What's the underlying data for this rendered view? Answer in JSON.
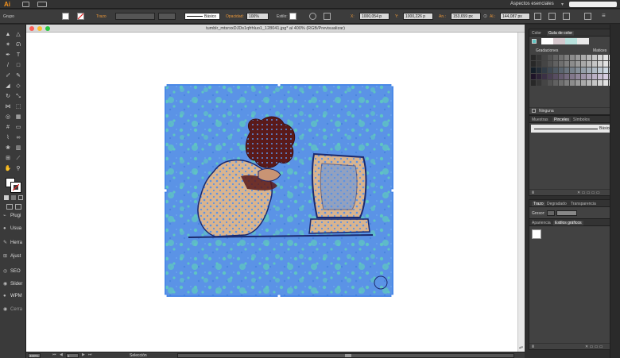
{
  "app": {
    "logo": "Ai",
    "workspace": "Aspectos esenciales"
  },
  "control_bar": {
    "selection_label": "Grupo",
    "stroke_label": "Trazo",
    "brush_label": "Básico",
    "opacity_label": "Opacidad:",
    "opacity_value": "100%",
    "style_label": "Estilo:",
    "x_label": "X:",
    "x_value": "1000,054 p",
    "y_label": "Y:",
    "y_value": "1000,226 p",
    "w_label": "An.:",
    "w_value": "153,659 px",
    "h_label": "Al.:",
    "h_value": "144,087 px"
  },
  "document": {
    "title": "tumblr_mtsrxxDJDs1qfrhluo1_128041.jpg* al 400% (RGB/Previsualizar)",
    "zoom": "400%",
    "page": "1",
    "status": "Selección"
  },
  "left_panels": [
    "Plugi",
    "Usua",
    "Herra",
    "Ajust",
    "SEO",
    "Slider",
    "WPM",
    "Cerra"
  ],
  "color_panel": {
    "tabs": [
      "Color",
      "Guía de color"
    ],
    "group_headers": [
      "Gradaciones",
      "Matices"
    ],
    "footer": "Ninguna"
  },
  "brushes_panel": {
    "tabs": [
      "Muestras",
      "Pinceles",
      "Símbolos"
    ],
    "brush_name": "Básico"
  },
  "stroke_panel": {
    "tabs": [
      "Trazo",
      "Degradado",
      "Transparencia"
    ],
    "weight_label": "Grosor:"
  },
  "appearance_panel": {
    "tabs": [
      "Apariencia",
      "Estilos gráficos"
    ]
  },
  "colors": {
    "background_blue": "#5b93e6",
    "teal": "#5fc4c2",
    "dark_brown": "#5a1a1a",
    "navy": "#1c2a6e",
    "tan": "#d9b48f",
    "selection": "#3b7fe8"
  }
}
